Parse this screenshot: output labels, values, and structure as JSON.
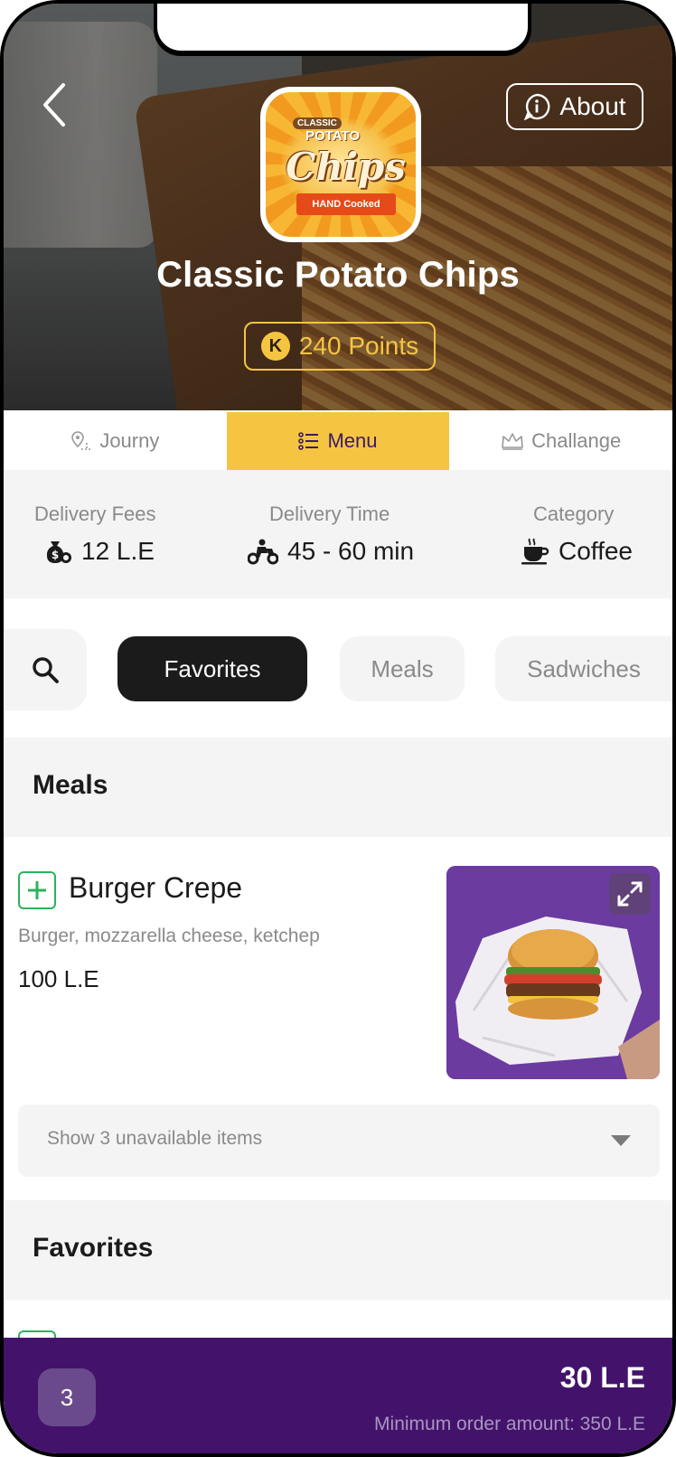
{
  "header": {
    "about_label": "About",
    "store_name": "Classic Potato Chips",
    "points_label": "240 Points",
    "points_coin_letter": "K",
    "logo": {
      "top_text": "CLASSIC",
      "mid_text": "POTATO",
      "main_text": "Chips",
      "banner_text": "HAND Cooked"
    }
  },
  "tabs": [
    {
      "label": "Journy",
      "icon": "map-pin-icon",
      "active": false
    },
    {
      "label": "Menu",
      "icon": "list-icon",
      "active": true
    },
    {
      "label": "Challange",
      "icon": "crown-icon",
      "active": false
    }
  ],
  "info": {
    "delivery_fees": {
      "label": "Delivery Fees",
      "value": "12 L.E",
      "icon": "money-bag-icon"
    },
    "delivery_time": {
      "label": "Delivery Time",
      "value": "45 - 60 min",
      "icon": "scooter-icon"
    },
    "category": {
      "label": "Category",
      "value": "Coffee",
      "icon": "coffee-cup-icon"
    }
  },
  "filters": [
    "Favorites",
    "Meals",
    "Sadwiches"
  ],
  "sections": {
    "meals_title": "Meals",
    "favorites_title": "Favorites"
  },
  "item": {
    "name": "Burger Crepe",
    "description": "Burger, mozzarella cheese, ketchep",
    "price": "100 L.E"
  },
  "unavailable_label": "Show 3 unavailable items",
  "cart": {
    "count": "3",
    "total": "30 L.E",
    "minimum": "Minimum order amount: 350 L.E"
  },
  "colors": {
    "accent_yellow": "#f5c542",
    "brand_purple": "#43136b",
    "add_green": "#2bb35a"
  }
}
